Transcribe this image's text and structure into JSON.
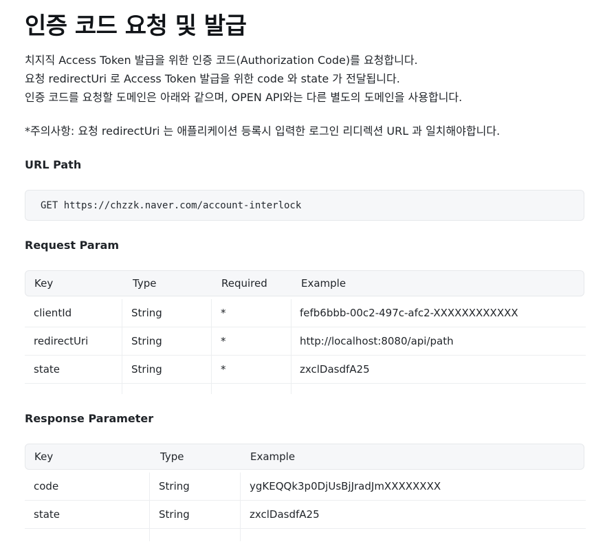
{
  "title": "인증 코드 요청 및 발급",
  "intro": [
    "치지직 Access Token 발급을 위한 인증 코드(Authorization Code)를 요청합니다.",
    "요청 redirectUri 로 Access Token 발급을 위한 code 와 state 가 전달됩니다.",
    "인증 코드를 요청할 도메인은 아래와 같으며, OPEN API와는 다른 별도의 도메인을 사용합니다."
  ],
  "notice": "*주의사항:  요청 redirectUri 는 애플리케이션 등록시 입력한 로그인 리디렉션 URL 과 일치해야합니다.",
  "url_path": {
    "heading": "URL Path",
    "code": "GET https://chzzk.naver.com/account-interlock"
  },
  "request_param": {
    "heading": "Request Param",
    "columns": [
      "Key",
      "Type",
      "Required",
      "Example"
    ],
    "rows": [
      [
        "clientId",
        "String",
        "*",
        "fefb6bbb-00c2-497c-afc2-XXXXXXXXXXXX"
      ],
      [
        "redirectUri",
        "String",
        "*",
        "http://localhost:8080/api/path"
      ],
      [
        "state",
        "String",
        "*",
        "zxclDasdfA25"
      ]
    ]
  },
  "response_param": {
    "heading": "Response Parameter",
    "columns": [
      "Key",
      "Type",
      "Example"
    ],
    "rows": [
      [
        "code",
        "String",
        "ygKEQQk3p0DjUsBjJradJmXXXXXXXX"
      ],
      [
        "state",
        "String",
        "zxclDasdfA25"
      ]
    ]
  }
}
